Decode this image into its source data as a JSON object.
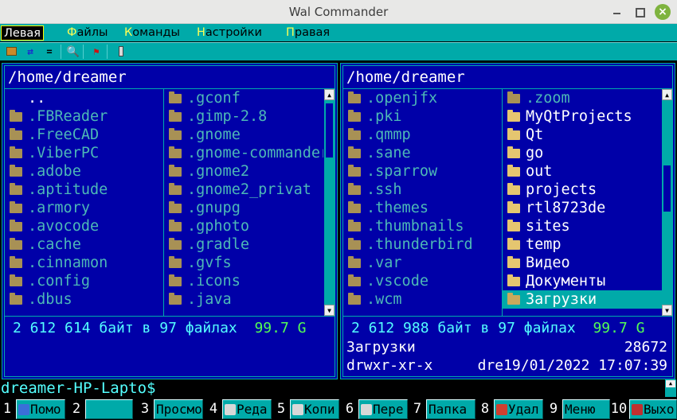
{
  "window": {
    "title": "Wal Commander"
  },
  "menu": [
    {
      "hk": "",
      "rest": "Левая",
      "active": true
    },
    {
      "hk": "Ф",
      "rest": "айлы",
      "active": false
    },
    {
      "hk": "К",
      "rest": "оманды",
      "active": false
    },
    {
      "hk": "Н",
      "rest": "астройки",
      "active": false
    },
    {
      "hk": "П",
      "rest": "равая",
      "active": false
    }
  ],
  "toolbar": [
    "refresh-icon",
    "compare-icon",
    "equal-icon",
    "search-icon",
    "flag-icon",
    "battery-icon"
  ],
  "left_panel": {
    "path": "/home/dreamer",
    "col1": [
      {
        "name": "..",
        "kind": "up"
      },
      {
        "name": ".FBReader",
        "kind": "hidden"
      },
      {
        "name": ".FreeCAD",
        "kind": "hidden"
      },
      {
        "name": ".ViberPC",
        "kind": "hidden"
      },
      {
        "name": ".adobe",
        "kind": "hidden"
      },
      {
        "name": ".aptitude",
        "kind": "hidden"
      },
      {
        "name": ".armory",
        "kind": "hidden"
      },
      {
        "name": ".avocode",
        "kind": "hidden"
      },
      {
        "name": ".cache",
        "kind": "hidden"
      },
      {
        "name": ".cinnamon",
        "kind": "hidden"
      },
      {
        "name": ".config",
        "kind": "hidden"
      },
      {
        "name": ".dbus",
        "kind": "hidden"
      }
    ],
    "col2": [
      {
        "name": ".gconf",
        "kind": "hidden"
      },
      {
        "name": ".gimp-2.8",
        "kind": "hidden"
      },
      {
        "name": ".gnome",
        "kind": "hidden"
      },
      {
        "name": ".gnome-commander",
        "kind": "hidden"
      },
      {
        "name": ".gnome2",
        "kind": "hidden"
      },
      {
        "name": ".gnome2_privat",
        "kind": "hidden"
      },
      {
        "name": ".gnupg",
        "kind": "hidden"
      },
      {
        "name": ".gphoto",
        "kind": "hidden"
      },
      {
        "name": ".gradle",
        "kind": "hidden"
      },
      {
        "name": ".gvfs",
        "kind": "hidden"
      },
      {
        "name": ".icons",
        "kind": "hidden"
      },
      {
        "name": ".java",
        "kind": "hidden"
      }
    ],
    "summary": {
      "text": "2 612 614 байт в 97 файлах",
      "free": "99.7 G"
    }
  },
  "right_panel": {
    "path": "/home/dreamer",
    "col1": [
      {
        "name": ".openjfx",
        "kind": "hidden"
      },
      {
        "name": ".pki",
        "kind": "hidden"
      },
      {
        "name": ".qmmp",
        "kind": "hidden"
      },
      {
        "name": ".sane",
        "kind": "hidden"
      },
      {
        "name": ".sparrow",
        "kind": "hidden"
      },
      {
        "name": ".ssh",
        "kind": "hidden"
      },
      {
        "name": ".themes",
        "kind": "hidden"
      },
      {
        "name": ".thumbnails",
        "kind": "hidden"
      },
      {
        "name": ".thunderbird",
        "kind": "hidden"
      },
      {
        "name": ".var",
        "kind": "hidden"
      },
      {
        "name": ".vscode",
        "kind": "hidden"
      },
      {
        "name": ".wcm",
        "kind": "hidden"
      }
    ],
    "col2": [
      {
        "name": ".zoom",
        "kind": "hidden"
      },
      {
        "name": "MyQtProjects",
        "kind": "visible"
      },
      {
        "name": "Qt",
        "kind": "visible"
      },
      {
        "name": "go",
        "kind": "visible"
      },
      {
        "name": "out",
        "kind": "visible"
      },
      {
        "name": "projects",
        "kind": "visible"
      },
      {
        "name": "rtl8723de",
        "kind": "visible"
      },
      {
        "name": "sites",
        "kind": "visible"
      },
      {
        "name": "temp",
        "kind": "visible"
      },
      {
        "name": "Видео",
        "kind": "visible"
      },
      {
        "name": "Документы",
        "kind": "visible"
      },
      {
        "name": "Загрузки",
        "kind": "sel"
      }
    ],
    "summary": {
      "text": "2 612 988 байт в 97 файлах",
      "free": "99.7 G"
    },
    "info": {
      "name": "Загрузки",
      "size": "28672",
      "perms": "drwxr-xr-x",
      "owner_date": "dre19/01/2022 17:07:39"
    }
  },
  "command_line": {
    "prompt": "dreamer-HP-Lapto$"
  },
  "fkeys": [
    {
      "num": "1",
      "label": "Помо",
      "icon": "help-icon",
      "color": "#3a6fd8"
    },
    {
      "num": "2",
      "label": "",
      "icon": "",
      "color": ""
    },
    {
      "num": "3",
      "label": "Просмо",
      "icon": "",
      "color": ""
    },
    {
      "num": "4",
      "label": "Реда",
      "icon": "edit-icon",
      "color": "#d8d8d8"
    },
    {
      "num": "5",
      "label": "Копи",
      "icon": "copy-icon",
      "color": "#d8d8d8"
    },
    {
      "num": "6",
      "label": "Пере",
      "icon": "move-icon",
      "color": "#d8d8d8"
    },
    {
      "num": "7",
      "label": "Папка",
      "icon": "",
      "color": ""
    },
    {
      "num": "8",
      "label": "Удал",
      "icon": "delete-icon",
      "color": "#d04030"
    },
    {
      "num": "9",
      "label": "Меню",
      "icon": "",
      "color": ""
    },
    {
      "num": "10",
      "label": "Выхо",
      "icon": "exit-icon",
      "color": "#c03030"
    }
  ]
}
